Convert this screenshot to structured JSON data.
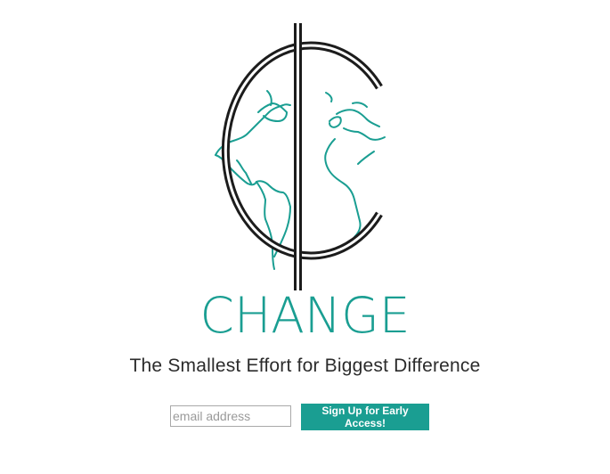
{
  "brand": {
    "name": "CHANGE",
    "tagline": "The Smallest Effort for Biggest Difference",
    "accent_color": "#1a9e92",
    "logo_icon": "cent-globe-icon"
  },
  "signup": {
    "email_placeholder": "email address",
    "email_value": "",
    "button_label": "Sign Up for Early Access!"
  }
}
